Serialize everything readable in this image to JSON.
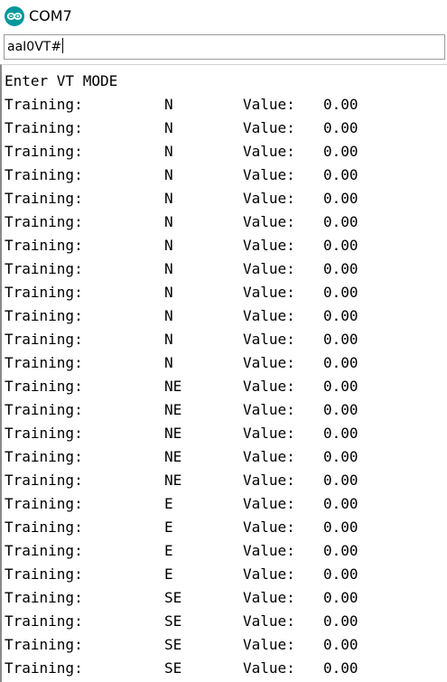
{
  "window": {
    "title": "COM7",
    "icon": "arduino-infinity-icon",
    "accent_color": "#00979c"
  },
  "send": {
    "value": "aaI0VT#"
  },
  "output": {
    "header": "Enter VT MODE",
    "rows": [
      {
        "label": "Training:",
        "direction": "N",
        "value_label": "Value:",
        "value": "0.00"
      },
      {
        "label": "Training:",
        "direction": "N",
        "value_label": "Value:",
        "value": "0.00"
      },
      {
        "label": "Training:",
        "direction": "N",
        "value_label": "Value:",
        "value": "0.00"
      },
      {
        "label": "Training:",
        "direction": "N",
        "value_label": "Value:",
        "value": "0.00"
      },
      {
        "label": "Training:",
        "direction": "N",
        "value_label": "Value:",
        "value": "0.00"
      },
      {
        "label": "Training:",
        "direction": "N",
        "value_label": "Value:",
        "value": "0.00"
      },
      {
        "label": "Training:",
        "direction": "N",
        "value_label": "Value:",
        "value": "0.00"
      },
      {
        "label": "Training:",
        "direction": "N",
        "value_label": "Value:",
        "value": "0.00"
      },
      {
        "label": "Training:",
        "direction": "N",
        "value_label": "Value:",
        "value": "0.00"
      },
      {
        "label": "Training:",
        "direction": "N",
        "value_label": "Value:",
        "value": "0.00"
      },
      {
        "label": "Training:",
        "direction": "N",
        "value_label": "Value:",
        "value": "0.00"
      },
      {
        "label": "Training:",
        "direction": "N",
        "value_label": "Value:",
        "value": "0.00"
      },
      {
        "label": "Training:",
        "direction": "NE",
        "value_label": "Value:",
        "value": "0.00"
      },
      {
        "label": "Training:",
        "direction": "NE",
        "value_label": "Value:",
        "value": "0.00"
      },
      {
        "label": "Training:",
        "direction": "NE",
        "value_label": "Value:",
        "value": "0.00"
      },
      {
        "label": "Training:",
        "direction": "NE",
        "value_label": "Value:",
        "value": "0.00"
      },
      {
        "label": "Training:",
        "direction": "NE",
        "value_label": "Value:",
        "value": "0.00"
      },
      {
        "label": "Training:",
        "direction": "E",
        "value_label": "Value:",
        "value": "0.00"
      },
      {
        "label": "Training:",
        "direction": "E",
        "value_label": "Value:",
        "value": "0.00"
      },
      {
        "label": "Training:",
        "direction": "E",
        "value_label": "Value:",
        "value": "0.00"
      },
      {
        "label": "Training:",
        "direction": "E",
        "value_label": "Value:",
        "value": "0.00"
      },
      {
        "label": "Training:",
        "direction": "SE",
        "value_label": "Value:",
        "value": "0.00"
      },
      {
        "label": "Training:",
        "direction": "SE",
        "value_label": "Value:",
        "value": "0.00"
      },
      {
        "label": "Training:",
        "direction": "SE",
        "value_label": "Value:",
        "value": "0.00"
      },
      {
        "label": "Training:",
        "direction": "SE",
        "value_label": "Value:",
        "value": "0.00"
      }
    ]
  }
}
